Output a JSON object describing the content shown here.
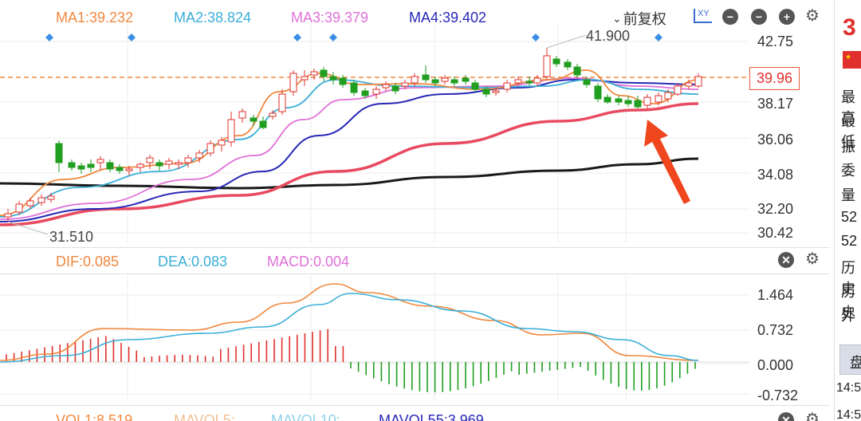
{
  "header": {
    "ma_labels": [
      {
        "text": "MA1:39.232",
        "color": "#f0883e"
      },
      {
        "text": "MA2:38.824",
        "color": "#3aafd8"
      },
      {
        "text": "MA3:39.379",
        "color": "#e070d8"
      },
      {
        "text": "MA4:39.402",
        "color": "#2828b8"
      }
    ],
    "adjust_label": "前复权",
    "xy_label": "XY"
  },
  "price_axis": [
    "42.75",
    "38.17",
    "36.06",
    "34.08",
    "32.20",
    "30.42"
  ],
  "current_price": "39.96",
  "high_label": "41.900",
  "low_label": "31.510",
  "macd_header": {
    "dif": "DIF:0.085",
    "dea": "DEA:0.083",
    "macd": "MACD:0.004"
  },
  "macd_axis": [
    "1.464",
    "0.732",
    "0.000",
    "-0.732"
  ],
  "vol_header": [
    "VOL1:8.519",
    "MAVOL5:",
    "MAVOL10:",
    "MAVOL55:3.969"
  ],
  "sidebar": {
    "price_partial": "3",
    "rows": [
      "最高",
      "最低",
      "振",
      "委",
      "量",
      "52",
      "52",
      "历史",
      "历史",
      "外"
    ],
    "tab_label": "盘",
    "times": [
      "14:5",
      "14:5"
    ]
  },
  "colors": {
    "up": "#e0302b",
    "down": "#1f9e1f",
    "ma1": "#f0883e",
    "ma2": "#3aafd8",
    "ma3": "#e070d8",
    "ma4": "#2828b8",
    "ma5": "#e84a5f",
    "ma6": "#1a1a1a"
  },
  "chart_data": {
    "type": "candlestick",
    "price_axis_ticks": [
      42.75,
      38.17,
      36.06,
      34.08,
      32.2,
      30.42
    ],
    "macd_axis_ticks": [
      1.464,
      0.732,
      0.0,
      -0.732
    ],
    "high": 41.9,
    "low": 31.51,
    "last": 39.96
  }
}
